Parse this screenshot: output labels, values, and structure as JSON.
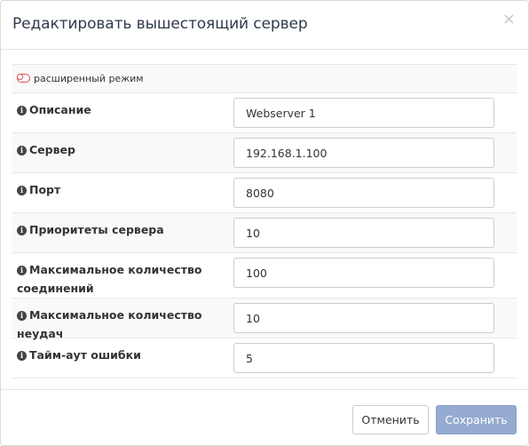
{
  "dialog": {
    "title": "Редактировать вышестоящий сервер",
    "close_glyph": "×"
  },
  "advanced_mode": {
    "label": "расширенный режим",
    "enabled": false,
    "toggle_color": "#d9534f"
  },
  "fields": [
    {
      "label": "Описание",
      "value": "Webserver 1"
    },
    {
      "label": "Сервер",
      "value": "192.168.1.100"
    },
    {
      "label": "Порт",
      "value": "8080"
    },
    {
      "label": "Приоритеты сервера",
      "value": "10"
    },
    {
      "label": "Максимальное количество соединений",
      "value": "100"
    },
    {
      "label": "Максимальное количество неудач",
      "value": "10"
    },
    {
      "label": "Тайм-аут ошибки",
      "value": "5"
    }
  ],
  "footer": {
    "cancel_label": "Отменить",
    "save_label": "Сохранить",
    "save_color": "#95abcf"
  }
}
